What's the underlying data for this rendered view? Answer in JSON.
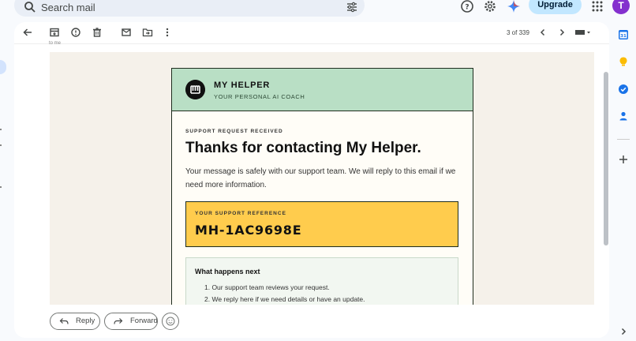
{
  "search": {
    "placeholder": "Search mail"
  },
  "header": {
    "upgrade_label": "Upgrade",
    "avatar_initial": "T"
  },
  "toolbar": {
    "counter": "3 of 339"
  },
  "sender_snippet": "to me",
  "email": {
    "brand": "MY HELPER",
    "tagline": "YOUR PERSONAL AI COACH",
    "eyebrow": "SUPPORT REQUEST RECEIVED",
    "title": "Thanks for contacting My Helper.",
    "message": "Your message is safely with our support team. We will reply to this email if we need more information.",
    "ref_label": "YOUR SUPPORT REFERENCE",
    "ref_code": "MH-1AC9698E",
    "next_title": "What happens next",
    "next_items": [
      "1. Our support team reviews your request.",
      "2. We reply here if we need details or have an update."
    ]
  },
  "reply_bar": {
    "reply_label": "Reply",
    "forward_label": "Forward"
  },
  "colors": {
    "accent": "#c2e7ff",
    "header_green": "#b9dfc5",
    "reference_yellow": "#ffcc4d",
    "avatar": "#8430ce"
  },
  "icons": [
    "search-icon",
    "filter-icon",
    "help-icon",
    "settings-icon",
    "gemini-icon",
    "apps-icon",
    "back-icon",
    "archive-icon",
    "report-spam-icon",
    "delete-icon",
    "mark-unread-icon",
    "move-to-icon",
    "more-icon",
    "prev-icon",
    "next-icon",
    "keyboard-icon",
    "calendar-icon",
    "keep-icon",
    "tasks-icon",
    "contacts-icon",
    "add-icon",
    "expand-icon",
    "reply-icon",
    "forward-icon",
    "emoji-icon"
  ]
}
